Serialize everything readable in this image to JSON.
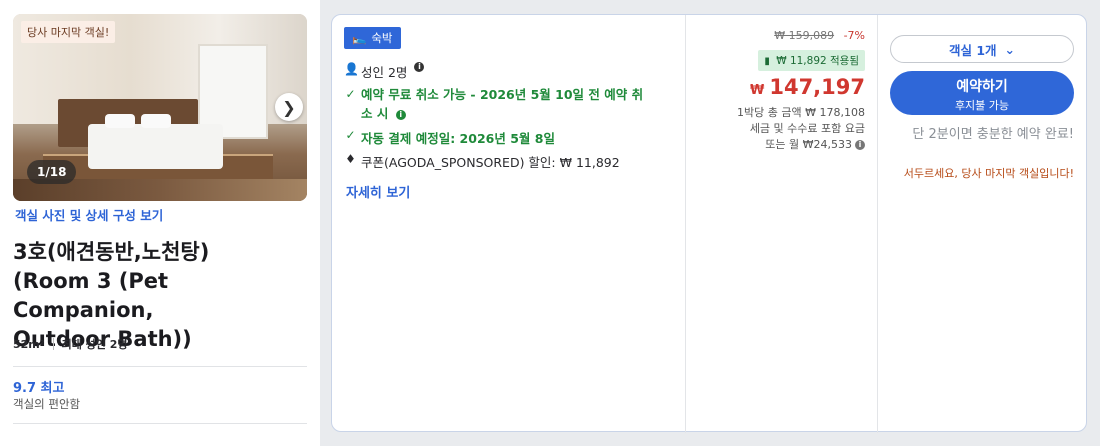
{
  "room_card": {
    "last_room_badge": "당사 마지막 객실!",
    "photo_counter": "1/18",
    "photo_link": "객실 사진 및 상세 구성 보기",
    "title_lines": [
      "3호(애견동반,노천탕)",
      "(Room 3 (Pet Companion,",
      "Outdoor Bath))"
    ],
    "size": "52m²",
    "max_occupancy": "최대 성인 2명",
    "rating": "9.7 최고",
    "rating_sub": "객실의 편안함"
  },
  "offer": {
    "stay_badge": "숙박",
    "adults": "성인 2명",
    "free_cancel_line1": "예약 무료 취소 가능 - 2026년 5월 10일 전 예약 취",
    "free_cancel_line2": "소 시",
    "auto_pay": "자동 결제 예정일: 2026년 5월 8일",
    "coupon": "쿠폰(AGODA_SPONSORED) 할인: ₩ 11,892",
    "details_link": "자세히 보기"
  },
  "pricing": {
    "original_price": "₩ 159,089",
    "discount_pct": "-7%",
    "applied_coupon": "₩ 11,892 적용됨",
    "currency": "₩",
    "price": "147,197",
    "per_night_line": "1박당 총 금액 ₩ 178,108",
    "tax_line": "세금 및 수수료 포함 요금",
    "monthly_line": "또는 월 ₩24,533"
  },
  "actions": {
    "room_select": "객실 1개",
    "book_label": "예약하기",
    "book_sub": "후지불 가능",
    "hurry_text": "단 2분이면 충분한 예약 완료!",
    "warn_text": "서두르세요, 당사 마지막 객실입니다!"
  },
  "colors": {
    "accent": "#2f67d8",
    "price_red": "#d0372f",
    "green": "#1f8a3a"
  }
}
